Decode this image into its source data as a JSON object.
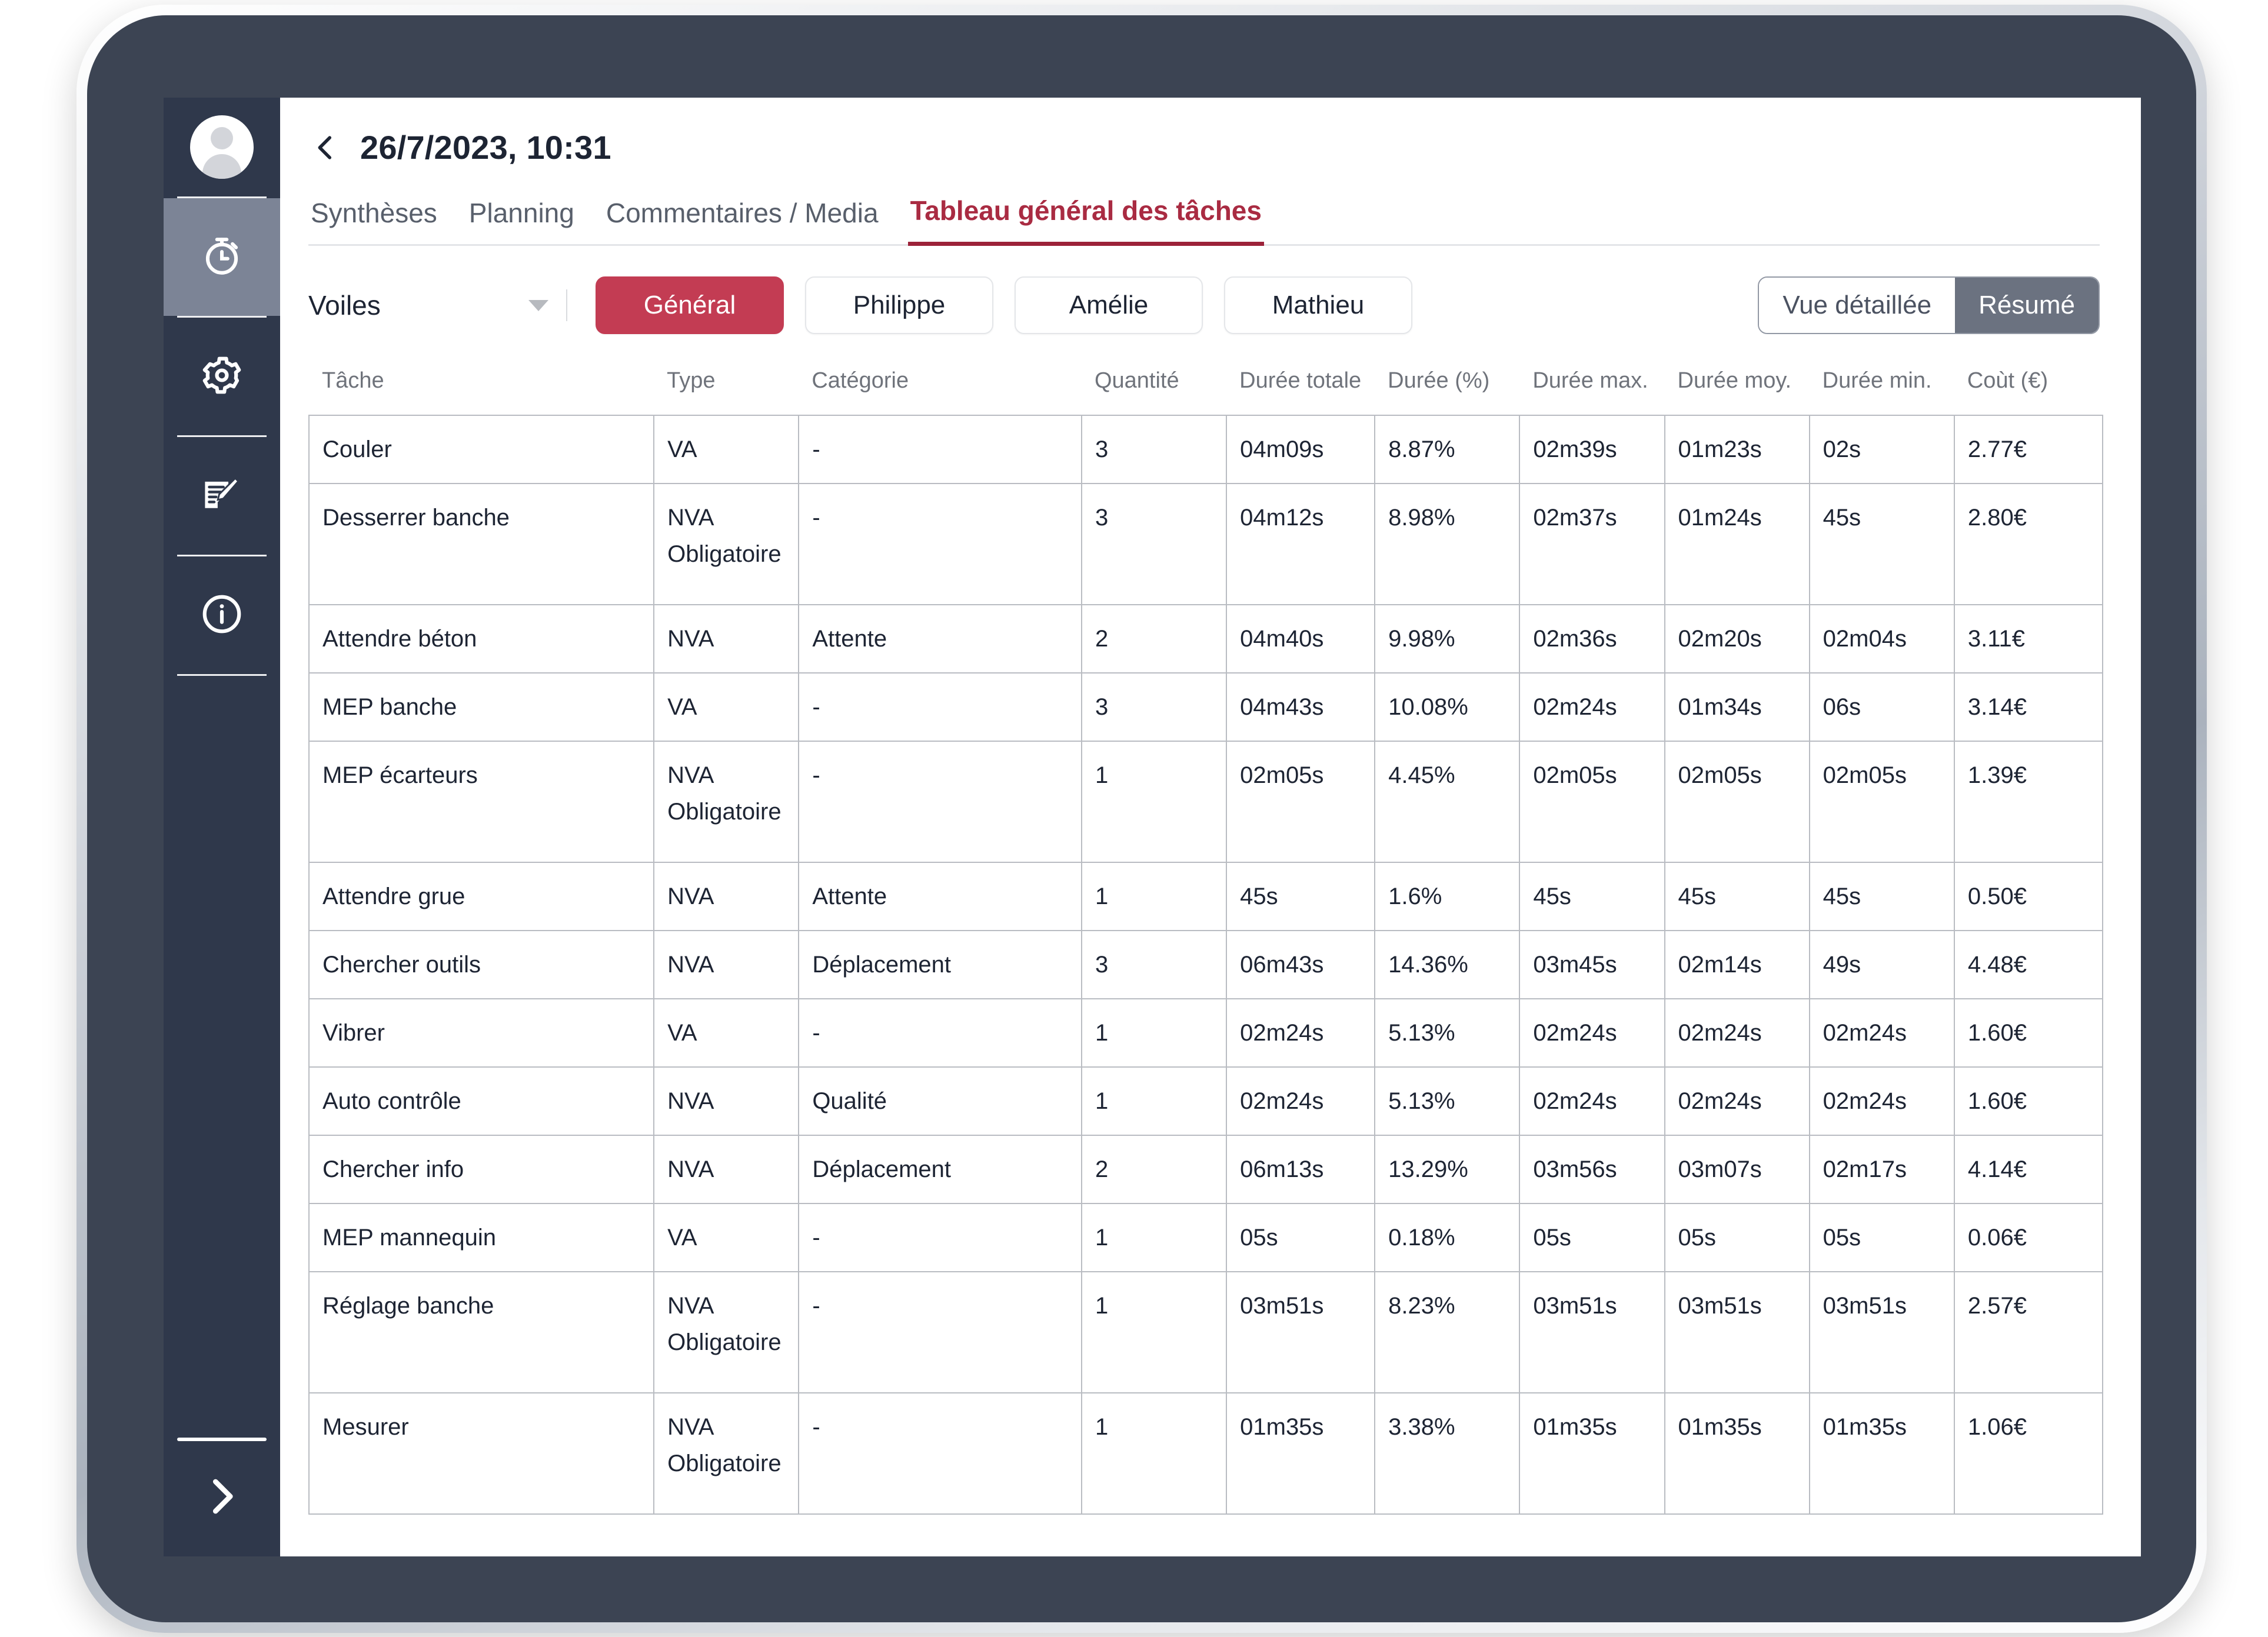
{
  "app": {
    "title": "26/7/2023, 10:31",
    "back_icon": "chevron-left-icon"
  },
  "sidebar": {
    "avatar_icon": "user-avatar-icon",
    "items": [
      {
        "icon": "stopwatch-icon",
        "name": "timer",
        "active": true
      },
      {
        "icon": "gear-icon",
        "name": "settings",
        "active": false
      },
      {
        "icon": "edit-document-icon",
        "name": "reports",
        "active": false
      },
      {
        "icon": "info-icon",
        "name": "info",
        "active": false
      }
    ],
    "expand_icon": "chevron-right-icon"
  },
  "tabs": [
    {
      "label": "Synthèses",
      "active": false
    },
    {
      "label": "Planning",
      "active": false
    },
    {
      "label": "Commentaires / Media",
      "active": false
    },
    {
      "label": "Tableau général des tâches",
      "active": true
    }
  ],
  "filters": {
    "select": {
      "value": "Voiles",
      "caret_icon": "chevron-down-icon"
    },
    "pills": [
      {
        "label": "Général",
        "active": true
      },
      {
        "label": "Philippe",
        "active": false
      },
      {
        "label": "Amélie",
        "active": false
      },
      {
        "label": "Mathieu",
        "active": false
      }
    ],
    "segmented": [
      {
        "label": "Vue détaillée",
        "active": false
      },
      {
        "label": "Résumé",
        "active": true
      }
    ]
  },
  "colors": {
    "accent_red": "#c33c53",
    "tab_active": "#a92b42",
    "segment_active": "#6b7280",
    "sidebar_bg": "#2f384b",
    "sidebar_active": "#7c8496",
    "tablet_body": "#3c4453"
  },
  "table": {
    "columns": [
      "Tâche",
      "Type",
      "Catégorie",
      "Quantité",
      "Durée totale",
      "Durée (%)",
      "Durée max.",
      "Durée moy.",
      "Durée min.",
      "Coùt (€)"
    ],
    "rows": [
      {
        "tache": "Couler",
        "type": "VA",
        "categorie": "-",
        "quantite": "3",
        "duree_totale": "04m09s",
        "duree_pct": "8.87%",
        "duree_max": "02m39s",
        "duree_moy": "01m23s",
        "duree_min": "02s",
        "cout": "2.77€",
        "tall": false
      },
      {
        "tache": "Desserrer banche",
        "type": "NVA\nObligatoire",
        "categorie": "-",
        "quantite": "3",
        "duree_totale": "04m12s",
        "duree_pct": "8.98%",
        "duree_max": "02m37s",
        "duree_moy": "01m24s",
        "duree_min": "45s",
        "cout": "2.80€",
        "tall": true
      },
      {
        "tache": "Attendre béton",
        "type": "NVA",
        "categorie": "Attente",
        "quantite": "2",
        "duree_totale": "04m40s",
        "duree_pct": "9.98%",
        "duree_max": "02m36s",
        "duree_moy": "02m20s",
        "duree_min": "02m04s",
        "cout": "3.11€",
        "tall": false
      },
      {
        "tache": "MEP banche",
        "type": "VA",
        "categorie": "-",
        "quantite": "3",
        "duree_totale": "04m43s",
        "duree_pct": "10.08%",
        "duree_max": "02m24s",
        "duree_moy": "01m34s",
        "duree_min": "06s",
        "cout": "3.14€",
        "tall": false
      },
      {
        "tache": "MEP écarteurs",
        "type": "NVA\nObligatoire",
        "categorie": "-",
        "quantite": "1",
        "duree_totale": "02m05s",
        "duree_pct": "4.45%",
        "duree_max": "02m05s",
        "duree_moy": "02m05s",
        "duree_min": "02m05s",
        "cout": "1.39€",
        "tall": true
      },
      {
        "tache": "Attendre grue",
        "type": "NVA",
        "categorie": "Attente",
        "quantite": "1",
        "duree_totale": "45s",
        "duree_pct": "1.6%",
        "duree_max": "45s",
        "duree_moy": "45s",
        "duree_min": "45s",
        "cout": "0.50€",
        "tall": false
      },
      {
        "tache": "Chercher outils",
        "type": "NVA",
        "categorie": "Déplacement",
        "quantite": "3",
        "duree_totale": "06m43s",
        "duree_pct": "14.36%",
        "duree_max": "03m45s",
        "duree_moy": "02m14s",
        "duree_min": "49s",
        "cout": "4.48€",
        "tall": false
      },
      {
        "tache": "Vibrer",
        "type": "VA",
        "categorie": "-",
        "quantite": "1",
        "duree_totale": "02m24s",
        "duree_pct": "5.13%",
        "duree_max": "02m24s",
        "duree_moy": "02m24s",
        "duree_min": "02m24s",
        "cout": "1.60€",
        "tall": false
      },
      {
        "tache": "Auto contrôle",
        "type": "NVA",
        "categorie": "Qualité",
        "quantite": "1",
        "duree_totale": "02m24s",
        "duree_pct": "5.13%",
        "duree_max": "02m24s",
        "duree_moy": "02m24s",
        "duree_min": "02m24s",
        "cout": "1.60€",
        "tall": false
      },
      {
        "tache": "Chercher info",
        "type": "NVA",
        "categorie": "Déplacement",
        "quantite": "2",
        "duree_totale": "06m13s",
        "duree_pct": "13.29%",
        "duree_max": "03m56s",
        "duree_moy": "03m07s",
        "duree_min": "02m17s",
        "cout": "4.14€",
        "tall": false
      },
      {
        "tache": "MEP mannequin",
        "type": "VA",
        "categorie": "-",
        "quantite": "1",
        "duree_totale": "05s",
        "duree_pct": "0.18%",
        "duree_max": "05s",
        "duree_moy": "05s",
        "duree_min": "05s",
        "cout": "0.06€",
        "tall": false
      },
      {
        "tache": "Réglage banche",
        "type": "NVA\nObligatoire",
        "categorie": "-",
        "quantite": "1",
        "duree_totale": "03m51s",
        "duree_pct": "8.23%",
        "duree_max": "03m51s",
        "duree_moy": "03m51s",
        "duree_min": "03m51s",
        "cout": "2.57€",
        "tall": true
      },
      {
        "tache": "Mesurer",
        "type": "NVA\nObligatoire",
        "categorie": "-",
        "quantite": "1",
        "duree_totale": "01m35s",
        "duree_pct": "3.38%",
        "duree_max": "01m35s",
        "duree_moy": "01m35s",
        "duree_min": "01m35s",
        "cout": "1.06€",
        "tall": true
      }
    ]
  }
}
